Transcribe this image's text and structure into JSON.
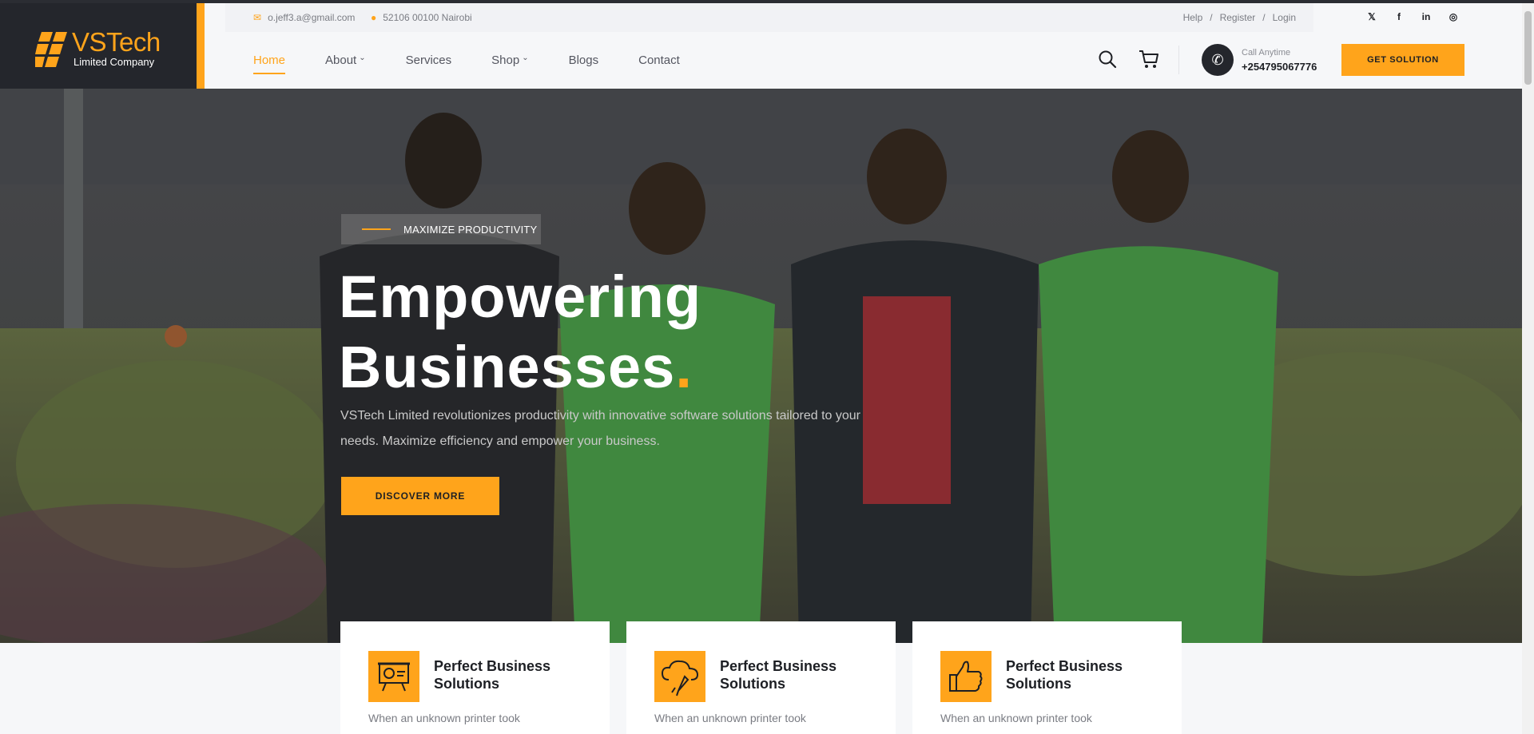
{
  "brand": {
    "name": "VSTech",
    "tagline": "Limited Company",
    "accent_color": "#ffa41b",
    "dark_color": "#24262c"
  },
  "topbar": {
    "email": "o.jeff3.a@gmail.com",
    "address": "52106 00100 Nairobi",
    "links": [
      "Help",
      "Register",
      "Login"
    ],
    "socials": [
      "twitter-icon",
      "facebook-icon",
      "linkedin-icon",
      "instagram-icon"
    ]
  },
  "nav": {
    "items": [
      {
        "label": "Home",
        "active": true
      },
      {
        "label": "About",
        "dropdown": true
      },
      {
        "label": "Services"
      },
      {
        "label": "Shop",
        "dropdown": true
      },
      {
        "label": "Blogs"
      },
      {
        "label": "Contact"
      }
    ],
    "call_label": "Call Anytime",
    "call_number": "+254795067776",
    "cta": "GET SOLUTION"
  },
  "hero": {
    "tag": "MAXIMIZE PRODUCTIVITY",
    "title_line1": "Empowering",
    "title_line2": "Businesses",
    "title_dot": ".",
    "text": "VSTech Limited revolutionizes productivity with innovative software solutions tailored to your needs. Maximize efficiency and empower your business.",
    "button": "DISCOVER MORE"
  },
  "features": [
    {
      "icon": "presentation-board-icon",
      "title": "Perfect Business Solutions",
      "desc": "When an unknown printer took"
    },
    {
      "icon": "cloud-rocket-icon",
      "title": "Perfect Business Solutions",
      "desc": "When an unknown printer took"
    },
    {
      "icon": "thumbs-up-icon",
      "title": "Perfect Business Solutions",
      "desc": "When an unknown printer took"
    }
  ]
}
